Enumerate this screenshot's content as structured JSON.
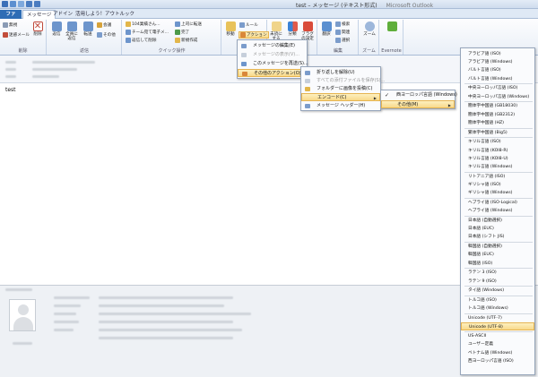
{
  "window": {
    "title": "test – メッセージ (テキスト形式)",
    "app_name": "Microsoft Outlook"
  },
  "tabs": [
    {
      "label": "ファイル"
    },
    {
      "label": "メッセージ"
    },
    {
      "label": "アドイン"
    },
    {
      "label": "活用しよう！アウトルック"
    }
  ],
  "ribbon": {
    "groups": [
      {
        "label": "削除"
      },
      {
        "label": "返信"
      },
      {
        "label": "クイック操作"
      },
      {
        "label": "移動"
      },
      {
        "label": "タグ"
      },
      {
        "label": "編集"
      },
      {
        "label": "ズーム"
      },
      {
        "label": "Evernote"
      }
    ],
    "delete_group": {
      "ignore": "無視",
      "junk": "迷惑メール",
      "delete": "削除"
    },
    "reply_group": {
      "reply": "返信",
      "reply_all": "全員に返信",
      "forward": "転送",
      "meeting": "会議",
      "more": "その他"
    },
    "quick": {
      "item1": "104業績さん...",
      "item2": "チーム宛て電子メ...",
      "item3": "返信して削除",
      "item4": "上司に転送",
      "item5": "完了",
      "item6": "新規作成"
    },
    "move_group": {
      "move": "移動",
      "rules": "ルール",
      "actions": "アクション"
    },
    "tags_group": {
      "unread": "未読にする",
      "categorize": "分類",
      "follow_up": "フラグの設定"
    },
    "edit_group": {
      "translate": "翻訳",
      "find": "検索",
      "related": "関連",
      "select": "選択"
    },
    "zoom_group": {
      "zoom": "ズーム"
    }
  },
  "body": {
    "text": "test"
  },
  "menus": {
    "actions": [
      {
        "label": "メッセージの編集(E)",
        "disabled": false
      },
      {
        "label": "メッセージの表示(V)...",
        "disabled": true
      },
      {
        "label": "このメッセージを再送(S)...",
        "disabled": false
      },
      {
        "label": "その他のアクション(O)",
        "disabled": false
      }
    ],
    "other_actions": [
      {
        "label": "折り返しを解除(U)"
      },
      {
        "label": "すべての添付ファイルを保存(S)..."
      },
      {
        "label": "フォルダーに画像を投稿(C)"
      },
      {
        "label": "エンコード(C)"
      },
      {
        "label": "メッセージ ヘッダー(H)"
      }
    ],
    "encode": [
      {
        "label": "西ヨーロッパ言語 (Windows)",
        "checked": true
      },
      {
        "label": "その他(M)"
      }
    ],
    "encodings": [
      "アラビア語 (ISO)",
      "アラビア語 (Windows)",
      "バルト言語 (ISO)",
      "バルト言語 (Windows)",
      "中央ヨーロッパ言語 (ISO)",
      "中央ヨーロッパ言語 (Windows)",
      "簡体字中国語 (GB18030)",
      "簡体字中国語 (GB2312)",
      "簡体字中国語 (HZ)",
      "繁体字中国語 (Big5)",
      "キリル言語 (ISO)",
      "キリル言語 (KOI8-R)",
      "キリル言語 (KOI8-U)",
      "キリル言語 (Windows)",
      "リトアニア語 (ISO)",
      "ギリシャ語 (ISO)",
      "ギリシャ語 (Windows)",
      "ヘブライ語 (ISO-Logical)",
      "ヘブライ語 (Windows)",
      "日本語 (自動選択)",
      "日本語 (EUC)",
      "日本語 (シフト JIS)",
      "韓国語 (自動選択)",
      "韓国語 (EUC)",
      "韓国語 (ISO)",
      "ラテン 3 (ISO)",
      "ラテン 9 (ISO)",
      "タイ語 (Windows)",
      "トルコ語 (ISO)",
      "トルコ語 (Windows)",
      "Unicode (UTF-7)",
      "Unicode (UTF-8)",
      "US-ASCII",
      "ユーザー定義",
      "ベトナム語 (Windows)",
      "西ヨーロッパ言語 (ISO)"
    ]
  },
  "colors": {
    "accent": "#2e6db5",
    "highlight": "#f8d98a",
    "ribbon_bg": "#e9eff7"
  }
}
